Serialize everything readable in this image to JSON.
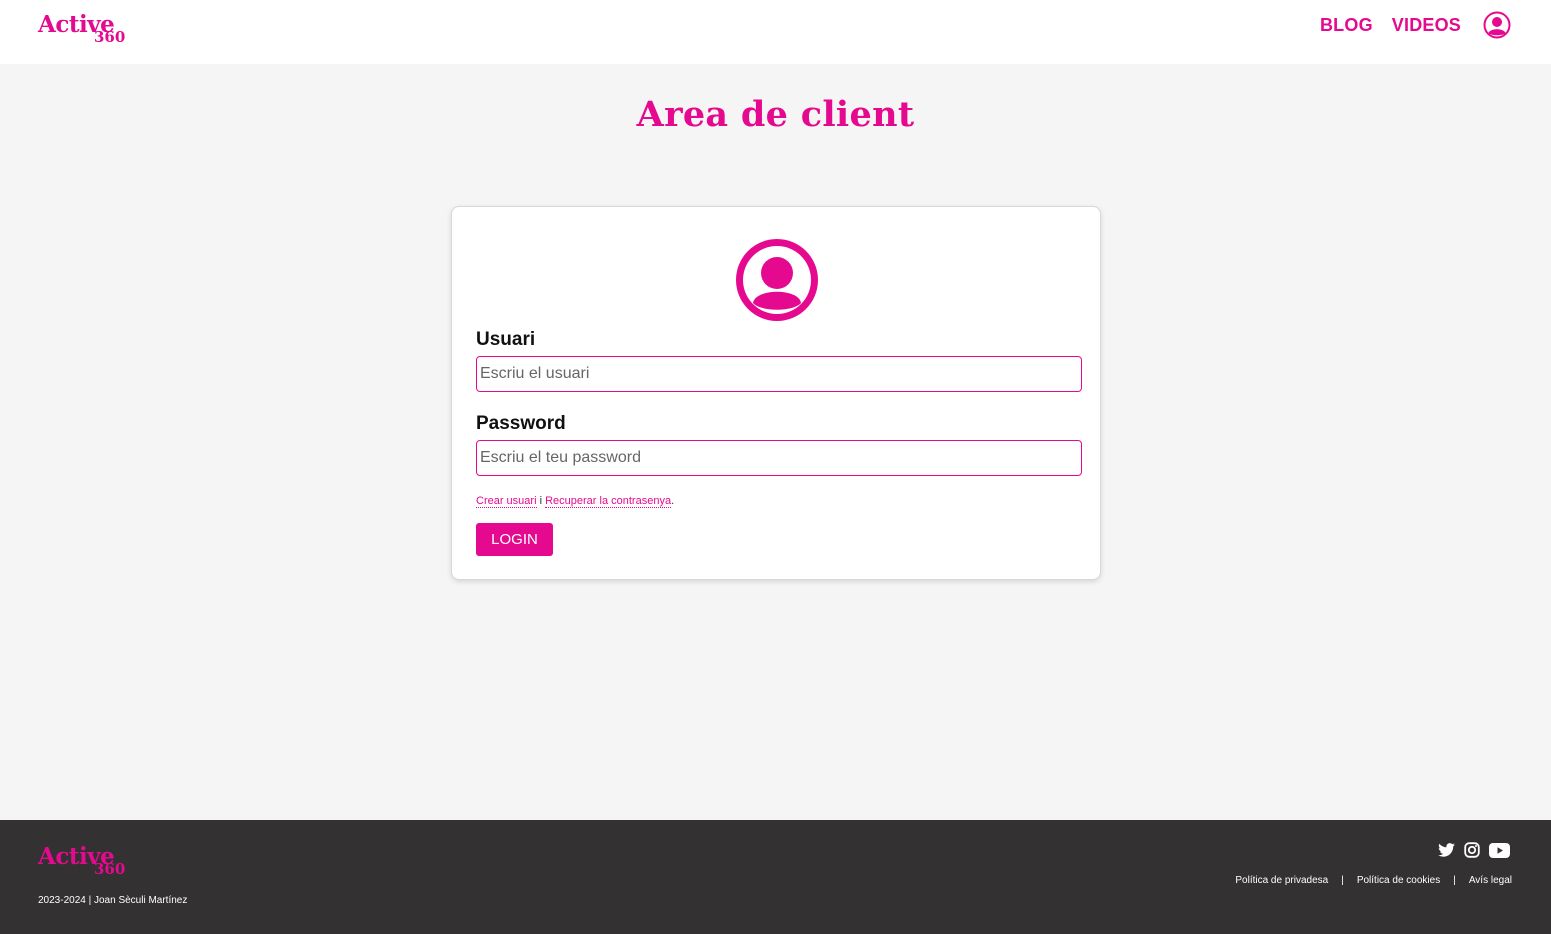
{
  "brand": {
    "logo_word": "Active",
    "logo_number": "360",
    "color": "#e5098f"
  },
  "nav": {
    "blog": "BLOG",
    "videos": "VIDEOS",
    "account_icon": "user-circle-icon"
  },
  "page": {
    "title": "Area de client"
  },
  "login": {
    "avatar_icon": "user-avatar-icon",
    "user_label": "Usuari",
    "user_placeholder": "Escriu el usuari",
    "password_label": "Password",
    "password_placeholder": "Escriu el teu password",
    "create_user": "Crear usuari",
    "connector": "i",
    "recover_password": "Recuperar la contrasenya",
    "period": ".",
    "submit": "LOGIN"
  },
  "footer": {
    "copyright": "2023-2024 | Joan Sèculi Martínez",
    "social": [
      "twitter-icon",
      "instagram-icon",
      "youtube-icon"
    ],
    "legal": {
      "privacy": "Política de privadesa",
      "cookies": "Política de cookies",
      "notice": "Avís legal",
      "separator": "|"
    },
    "background": "#333131"
  }
}
